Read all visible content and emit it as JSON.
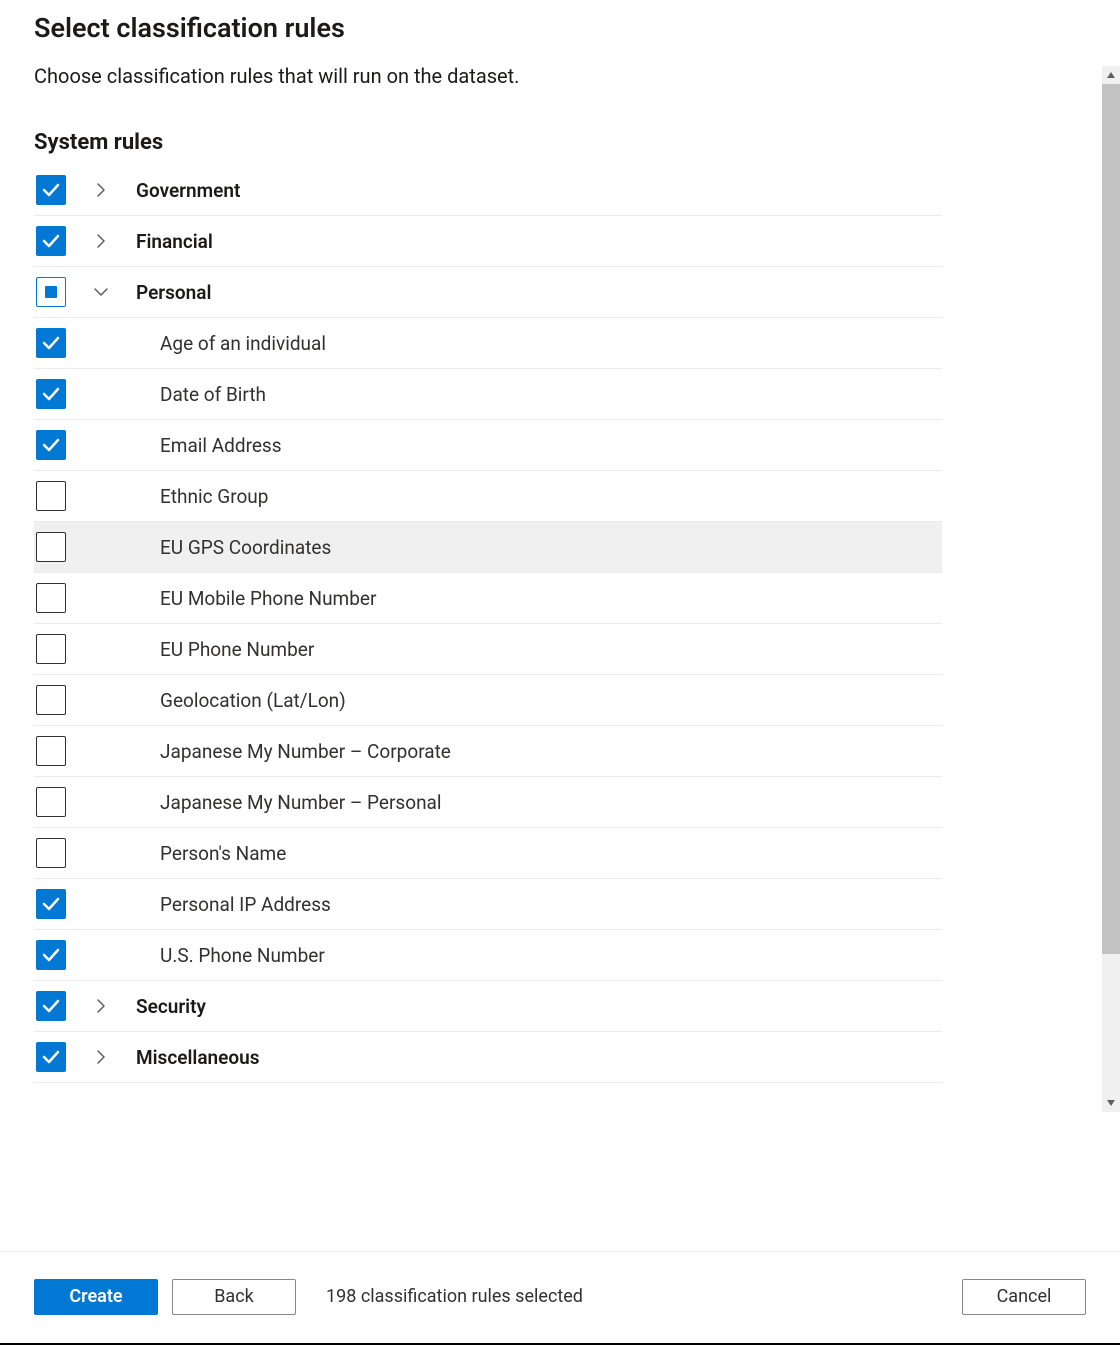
{
  "header": {
    "title": "Select classification rules",
    "subtitle": "Choose classification rules that will run on the dataset."
  },
  "section": {
    "title": "System rules"
  },
  "categories": [
    {
      "id": "government",
      "label": "Government",
      "state": "checked",
      "expanded": false,
      "items": []
    },
    {
      "id": "financial",
      "label": "Financial",
      "state": "checked",
      "expanded": false,
      "items": []
    },
    {
      "id": "personal",
      "label": "Personal",
      "state": "indeterminate",
      "expanded": true,
      "items": [
        {
          "label": "Age of an individual",
          "checked": true,
          "hover": false
        },
        {
          "label": "Date of Birth",
          "checked": true,
          "hover": false
        },
        {
          "label": "Email Address",
          "checked": true,
          "hover": false
        },
        {
          "label": "Ethnic Group",
          "checked": false,
          "hover": false
        },
        {
          "label": "EU GPS Coordinates",
          "checked": false,
          "hover": true
        },
        {
          "label": "EU Mobile Phone Number",
          "checked": false,
          "hover": false
        },
        {
          "label": "EU Phone Number",
          "checked": false,
          "hover": false
        },
        {
          "label": "Geolocation (Lat/Lon)",
          "checked": false,
          "hover": false
        },
        {
          "label": "Japanese My Number – Corporate",
          "checked": false,
          "hover": false
        },
        {
          "label": "Japanese My Number – Personal",
          "checked": false,
          "hover": false
        },
        {
          "label": "Person's Name",
          "checked": false,
          "hover": false
        },
        {
          "label": "Personal IP Address",
          "checked": true,
          "hover": false
        },
        {
          "label": "U.S. Phone Number",
          "checked": true,
          "hover": false
        }
      ]
    },
    {
      "id": "security",
      "label": "Security",
      "state": "checked",
      "expanded": false,
      "items": []
    },
    {
      "id": "miscellaneous",
      "label": "Miscellaneous",
      "state": "checked",
      "expanded": false,
      "items": []
    }
  ],
  "footer": {
    "create_label": "Create",
    "back_label": "Back",
    "cancel_label": "Cancel",
    "selected_text": "198 classification rules selected"
  }
}
